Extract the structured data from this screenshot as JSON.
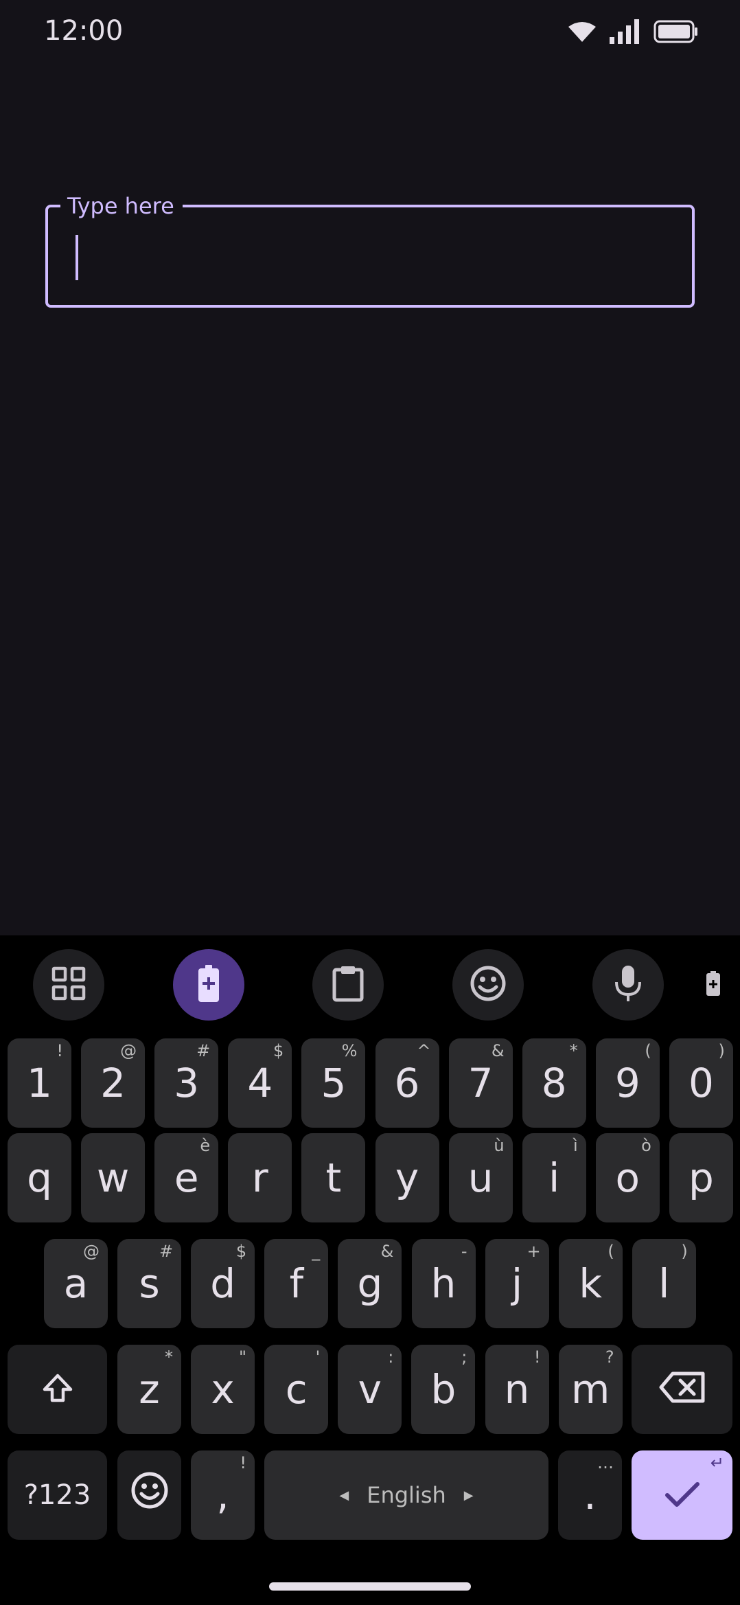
{
  "status_bar": {
    "time": "12:00",
    "icons": [
      "wifi-icon",
      "signal-icon",
      "battery-icon"
    ]
  },
  "text_field": {
    "label": "Type here",
    "value": "",
    "accent_color": "#d0bcff"
  },
  "keyboard": {
    "toolbar": [
      "apps-grid-icon",
      "battery-saver-icon",
      "clipboard-icon",
      "emoji-icon",
      "microphone-icon",
      "battery-small-icon"
    ],
    "toolbar_active": "battery-saver-icon",
    "number_row": [
      {
        "key": "1",
        "hint": "!"
      },
      {
        "key": "2",
        "hint": "@"
      },
      {
        "key": "3",
        "hint": "#"
      },
      {
        "key": "4",
        "hint": "$"
      },
      {
        "key": "5",
        "hint": "%"
      },
      {
        "key": "6",
        "hint": "^"
      },
      {
        "key": "7",
        "hint": "&"
      },
      {
        "key": "8",
        "hint": "*"
      },
      {
        "key": "9",
        "hint": "("
      },
      {
        "key": "0",
        "hint": ")"
      }
    ],
    "row1": [
      {
        "key": "q",
        "hint": ""
      },
      {
        "key": "w",
        "hint": ""
      },
      {
        "key": "e",
        "hint": "è"
      },
      {
        "key": "r",
        "hint": ""
      },
      {
        "key": "t",
        "hint": ""
      },
      {
        "key": "y",
        "hint": ""
      },
      {
        "key": "u",
        "hint": "ù"
      },
      {
        "key": "i",
        "hint": "ì"
      },
      {
        "key": "o",
        "hint": "ò"
      },
      {
        "key": "p",
        "hint": ""
      }
    ],
    "row2": [
      {
        "key": "a",
        "hint": "@"
      },
      {
        "key": "s",
        "hint": "#"
      },
      {
        "key": "d",
        "hint": "$"
      },
      {
        "key": "f",
        "hint": "_"
      },
      {
        "key": "g",
        "hint": "&"
      },
      {
        "key": "h",
        "hint": "-"
      },
      {
        "key": "j",
        "hint": "+"
      },
      {
        "key": "k",
        "hint": "("
      },
      {
        "key": "l",
        "hint": ")"
      }
    ],
    "row3": [
      {
        "key": "z",
        "hint": "*"
      },
      {
        "key": "x",
        "hint": "\""
      },
      {
        "key": "c",
        "hint": "'"
      },
      {
        "key": "v",
        "hint": ":"
      },
      {
        "key": "b",
        "hint": ";"
      },
      {
        "key": "n",
        "hint": "!"
      },
      {
        "key": "m",
        "hint": "?"
      }
    ],
    "bottom": {
      "symbols_label": "?123",
      "comma": ",",
      "comma_hint": "!",
      "space_label": "English",
      "period": ".",
      "period_hint": "…",
      "enter_hint": "↵"
    },
    "key_color": "#2b2b2d",
    "function_key_color": "#1e1e20",
    "enter_color": "#d0bcff",
    "active_tool_color": "#4f378a"
  }
}
